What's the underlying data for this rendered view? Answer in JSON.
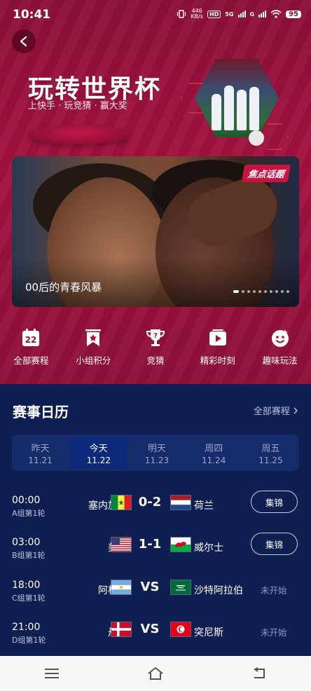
{
  "status_bar": {
    "time": "10:41",
    "net_speed_value": "446",
    "net_speed_unit": "KB/s",
    "hd_label": "HD",
    "signal1_label": "5G",
    "signal2_label": "G",
    "battery": "95"
  },
  "header": {
    "title": "玩转世界杯",
    "subtitle": "上快手 · 玩竞猜 · 赢大奖"
  },
  "banner": {
    "tag": "焦点话题",
    "caption": "00后的青春风暴",
    "dot_count": 10,
    "active_dot": 0
  },
  "menu": {
    "calendar_badge": "22",
    "items": [
      {
        "label": "全部赛程",
        "icon": "calendar-icon"
      },
      {
        "label": "小组积分",
        "icon": "ranking-bookmark-icon"
      },
      {
        "label": "竞猜",
        "icon": "trophy-question-icon"
      },
      {
        "label": "精彩时刻",
        "icon": "play-video-icon"
      },
      {
        "label": "趣味玩法",
        "icon": "smile-face-icon"
      }
    ]
  },
  "schedule": {
    "title": "赛事日历",
    "all_link": "全部赛程",
    "days": [
      {
        "name": "昨天",
        "date": "11.21",
        "active": false
      },
      {
        "name": "今天",
        "date": "11.22",
        "active": true
      },
      {
        "name": "明天",
        "date": "11.23",
        "active": false
      },
      {
        "name": "周四",
        "date": "11.24",
        "active": false
      },
      {
        "name": "周五",
        "date": "11.25",
        "active": false
      }
    ],
    "matches": [
      {
        "time": "00:00",
        "group": "A组第1轮",
        "home": "塞内加尔",
        "home_flag": "senegal",
        "score": "0-2",
        "away": "荷兰",
        "away_flag": "netherlands",
        "action": "集锦",
        "state": ""
      },
      {
        "time": "03:00",
        "group": "B组第1轮",
        "home": "美国",
        "home_flag": "usa",
        "score": "1-1",
        "away": "威尔士",
        "away_flag": "wales",
        "action": "集锦",
        "state": ""
      },
      {
        "time": "18:00",
        "group": "C组第1轮",
        "home": "阿根廷",
        "home_flag": "argentina",
        "score": "VS",
        "away": "沙特阿拉伯",
        "away_flag": "saudi-arabia",
        "action": "",
        "state": "未开始"
      },
      {
        "time": "21:00",
        "group": "D组第1轮",
        "home": "丹麦",
        "home_flag": "denmark",
        "score": "VS",
        "away": "突尼斯",
        "away_flag": "tunisia",
        "action": "",
        "state": "未开始"
      }
    ]
  },
  "colors": {
    "header_red": "#a3123f",
    "navy": "#0f1f52",
    "tab_strip": "#162b6a",
    "tab_active": "#0b2a7c"
  }
}
